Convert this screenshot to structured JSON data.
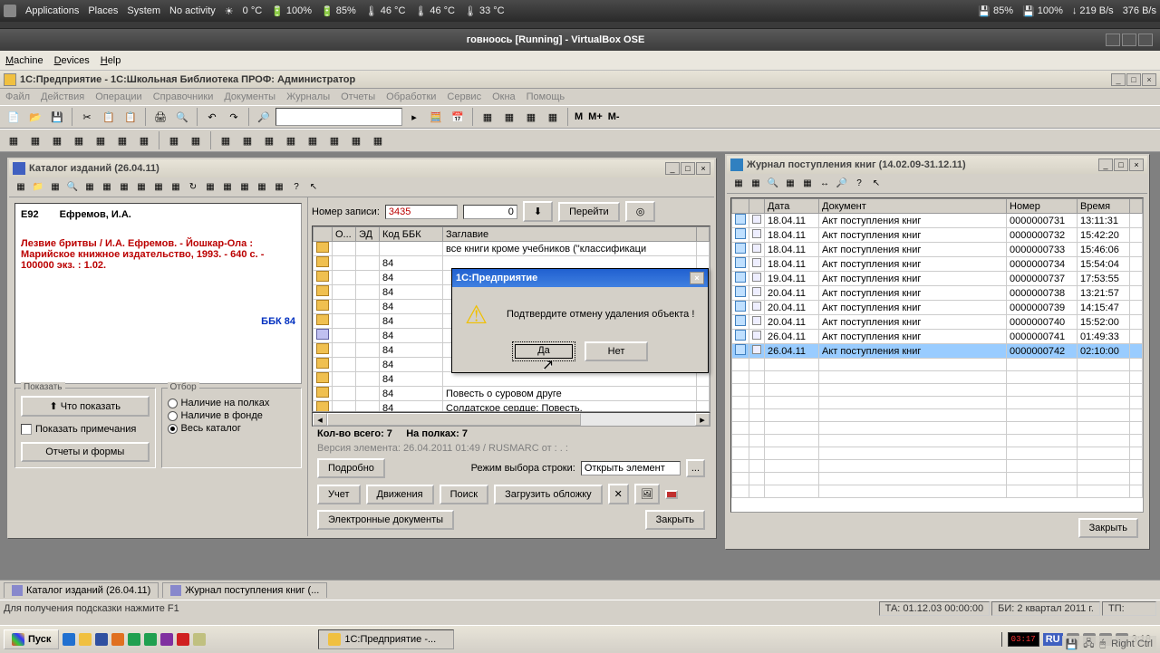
{
  "gnome": {
    "apps": "Applications",
    "places": "Places",
    "system": "System",
    "activity": "No activity",
    "temp1": "0 °C",
    "bat1": "100%",
    "bat2": "85%",
    "cpu1": "46 °C",
    "cpu2": "46 °C",
    "cpu3": "33 °C",
    "disk1": "85%",
    "disk2": "100%",
    "net1": "219 B/s",
    "net2": "376 B/s"
  },
  "vbox": {
    "title": "говноось [Running] - VirtualBox OSE",
    "menu": [
      "Machine",
      "Devices",
      "Help"
    ]
  },
  "onec": {
    "title": "1С:Предприятие - 1С:Школьная Библиотека ПРОФ:  Администратор",
    "menu": [
      "Файл",
      "Действия",
      "Операции",
      "Справочники",
      "Документы",
      "Журналы",
      "Отчеты",
      "Обработки",
      "Сервис",
      "Окна",
      "Помощь"
    ],
    "tb_m": "M",
    "tb_mp": "M+",
    "tb_mm": "M-"
  },
  "catalog": {
    "title": "Каталог изданий (26.04.11)",
    "code": "Е92",
    "author": "Ефремов, И.А.",
    "desc": "Лезвие бритвы / И.А. Ефремов. - Йошкар-Ола : Марийское книжное издательство, 1993. - 640 с. - 100000 экз. : 1.02.",
    "bbk": "ББК 84",
    "show_group": "Показать",
    "what_show": "Что показать",
    "show_notes": "Показать примечания",
    "reports": "Отчеты и формы",
    "filter_group": "Отбор",
    "r1": "Наличие на полках",
    "r2": "Наличие в фонде",
    "r3": "Весь каталог",
    "rec_label": "Номер записи:",
    "rec_no": "3435",
    "rec_idx": "0",
    "go": "Перейти",
    "cols": [
      "О...",
      "ЭД",
      "Код ББК",
      "Заглавие"
    ],
    "first_row": "все книги кроме учебников (\"классификаци",
    "bbk_code": "84",
    "last_title1": "Повесть о суровом друге",
    "last_title2": "Солдатское сердце: Повесть.",
    "total": "Кол-во всего: 7",
    "onshelf": "На полках:   7",
    "version": "Версия элемента: 26.04.2011 01:49 / RUSMARC от : . :",
    "detail": "Подробно",
    "mode": "Режим выбора строки:",
    "mode_val": "Открыть элемент",
    "b_uchet": "Учет",
    "b_move": "Движения",
    "b_search": "Поиск",
    "b_cover": "Загрузить обложку",
    "b_edoc": "Электронные документы",
    "b_close": "Закрыть"
  },
  "journal": {
    "title": "Журнал поступления книг (14.02.09-31.12.11)",
    "cols": [
      "",
      "",
      "Дата",
      "Документ",
      "Номер",
      "Время"
    ],
    "doc": "Акт поступления книг",
    "rows": [
      {
        "d": "18.04.11",
        "n": "0000000731",
        "t": "13:11:31"
      },
      {
        "d": "18.04.11",
        "n": "0000000732",
        "t": "15:42:20"
      },
      {
        "d": "18.04.11",
        "n": "0000000733",
        "t": "15:46:06"
      },
      {
        "d": "18.04.11",
        "n": "0000000734",
        "t": "15:54:04"
      },
      {
        "d": "19.04.11",
        "n": "0000000737",
        "t": "17:53:55"
      },
      {
        "d": "20.04.11",
        "n": "0000000738",
        "t": "13:21:57"
      },
      {
        "d": "20.04.11",
        "n": "0000000739",
        "t": "14:15:47"
      },
      {
        "d": "20.04.11",
        "n": "0000000740",
        "t": "15:52:00"
      },
      {
        "d": "26.04.11",
        "n": "0000000741",
        "t": "01:49:33"
      },
      {
        "d": "26.04.11",
        "n": "0000000742",
        "t": "02:10:00",
        "sel": true
      }
    ],
    "close": "Закрыть"
  },
  "dialog": {
    "title": "1С:Предприятие",
    "msg": "Подтвердите отмену удаления объекта !",
    "yes": "Да",
    "no": "Нет"
  },
  "wintabs": {
    "t1": "Каталог изданий (26.04.11)",
    "t2": "Журнал поступления книг (..."
  },
  "status": {
    "hint": "Для получения подсказки нажмите F1",
    "ta": "ТА: 01.12.03  00:00:00",
    "bi": "БИ: 2 квартал 2011 г.",
    "tp": "ТП:"
  },
  "taskbar": {
    "start": "Пуск",
    "app": "1С:Предприятие -...",
    "clock_red": "03:17",
    "lang": "RU",
    "time": "3:18",
    "right_ctrl": "Right Ctrl"
  }
}
